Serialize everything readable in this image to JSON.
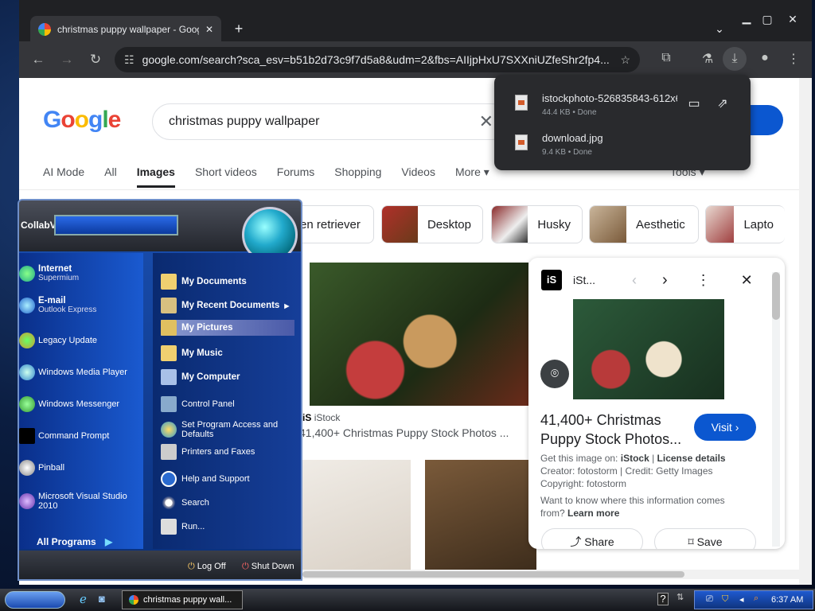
{
  "browser": {
    "tab_title": "christmas puppy wallpaper - Goog",
    "tab_close": "✕",
    "new_tab": "+",
    "url": "google.com/search?sca_esv=b51b2d73c9f7d5a8&udm=2&fbs=AIIjpHxU7SXXniUZfeShr2fp4..."
  },
  "google": {
    "logo": "Google",
    "query": "christmas puppy wallpaper",
    "signin_fragment": "in",
    "nav_tabs": [
      "AI Mode",
      "All",
      "Images",
      "Short videos",
      "Forums",
      "Shopping",
      "Videos",
      "More ▾"
    ],
    "tools": "Tools ▾",
    "chips": [
      "en retriever",
      "Desktop",
      "Husky",
      "Aesthetic",
      "Lapto"
    ],
    "result": {
      "source": "iStock",
      "title": "41,400+ Christmas Puppy Stock Photos ..."
    }
  },
  "panel": {
    "source": "iSt...",
    "title": "41,400+ Christmas Puppy Stock Photos...",
    "visit": "Visit ›",
    "get_label": "Get this image on:",
    "get_source": "iStock",
    "license": "License details",
    "creator": "Creator: fotostorm | Credit: Getty Images",
    "copyright": "Copyright: fotostorm",
    "info_text": "Want to know where this information comes from?",
    "learn_more": "Learn more",
    "share": "Share",
    "save": "Save"
  },
  "downloads": [
    {
      "name": "istockphoto-526835843-612x612",
      "meta": "44.4 KB • Done"
    },
    {
      "name": "download.jpg",
      "meta": "9.4 KB • Done"
    }
  ],
  "startmenu": {
    "user": "CollabVM",
    "pinned": [
      {
        "title": "Internet",
        "sub": "Supermium"
      },
      {
        "title": "E-mail",
        "sub": "Outlook Express"
      }
    ],
    "recent": [
      "Legacy Update",
      "Windows Media Player",
      "Windows Messenger",
      "Command Prompt",
      "Pinball",
      "Microsoft Visual Studio 2010"
    ],
    "all_programs": "All Programs",
    "places": [
      "My Documents",
      "My Recent Documents",
      "My Pictures",
      "My Music",
      "My Computer"
    ],
    "system": [
      "Control Panel",
      "Set Program Access and Defaults",
      "Printers and Faxes",
      "Help and Support",
      "Search",
      "Run..."
    ],
    "logoff": "Log Off",
    "shutdown": "Shut Down"
  },
  "taskbar": {
    "task_label": "christmas puppy wall...",
    "clock": "6:37 AM"
  },
  "colors": {
    "google_blue": "#0b57d0",
    "chrome_dark": "#35363a",
    "xp_blue": "#1a4fb0"
  }
}
